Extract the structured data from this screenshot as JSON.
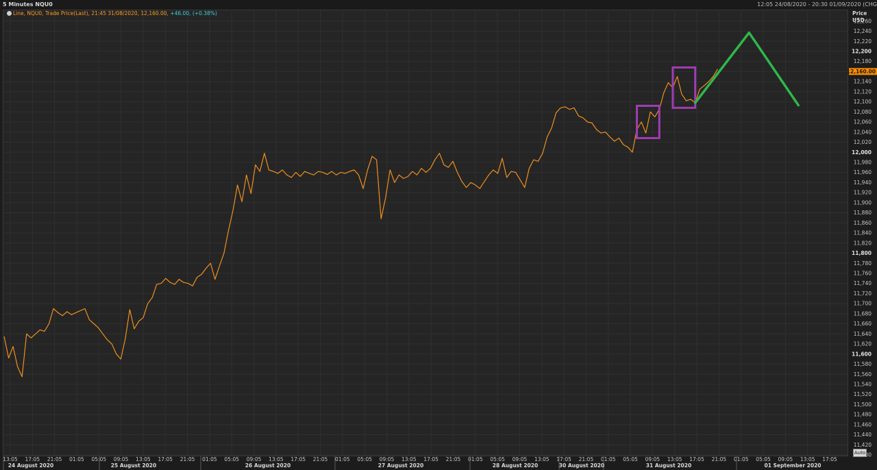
{
  "header": {
    "title": "5 Minutes NQU0",
    "range": "12:05 24/08/2020 - 20:30 01/09/2020 (CHG"
  },
  "legend": {
    "series_label": "Line, NQU0, Trade Price(Last), 21:45 31/08/2020, 12,160.00,",
    "change": "+46.00, (+0.38%)"
  },
  "price_axis": {
    "title_line1": "Price",
    "title_line2": "USD",
    "last_price_label": "12,160.00",
    "auto_button": "Auto"
  },
  "colors": {
    "price_line": "#f0901e",
    "last_price_tag": "#ff8c00",
    "highlight_box": "#a03cb4",
    "forecast_line": "#2fb84a",
    "grid": "#303030"
  },
  "chart_data": {
    "type": "line",
    "title": "5 Minutes NQU0",
    "ylabel": "Price USD",
    "ylim": [
      11400,
      12280
    ],
    "yticks": [
      11400,
      11420,
      11440,
      11460,
      11480,
      11500,
      11520,
      11540,
      11560,
      11580,
      11600,
      11620,
      11640,
      11660,
      11680,
      11700,
      11720,
      11740,
      11760,
      11780,
      11800,
      11820,
      11840,
      11860,
      11880,
      11900,
      11920,
      11940,
      11960,
      11980,
      12000,
      12020,
      12040,
      12060,
      12080,
      12100,
      12120,
      12140,
      12160,
      12180,
      12200,
      12220,
      12240,
      12260
    ],
    "ytick_labels": [
      "11,400",
      "11,420",
      "11,440",
      "11,460",
      "11,480",
      "11,500",
      "11,520",
      "11,540",
      "11,560",
      "11,580",
      "11,600",
      "11,620",
      "11,640",
      "11,660",
      "11,680",
      "11,700",
      "11,720",
      "11,740",
      "11,760",
      "11,780",
      "11,800",
      "11,820",
      "11,840",
      "11,860",
      "11,880",
      "11,900",
      "11,920",
      "11,940",
      "11,960",
      "11,980",
      "12,000",
      "12,020",
      "12,040",
      "12,060",
      "12,080",
      "12,100",
      "12,120",
      "12,140",
      "12,160",
      "12,180",
      "12,200",
      "12,220",
      "12,240",
      "12,260"
    ],
    "ytick_bold": [
      "11,600",
      "11,800",
      "12,000",
      "12,200"
    ],
    "x_time_ticks": [
      "13:05",
      "17:05",
      "21:05",
      "01:05",
      "05:05",
      "09:05",
      "13:05",
      "17:05",
      "21:05",
      "01:05",
      "05:05",
      "09:05",
      "13:05",
      "17:05",
      "21:05",
      "01:05",
      "05:05",
      "09:05",
      "13:05",
      "17:05",
      "21:05",
      "01:05",
      "05:05",
      "09:05",
      "13:05",
      "17:05",
      "21:05",
      "01:05",
      "05:05",
      "09:05",
      "13:05",
      "17:05",
      "21:05",
      "01:05",
      "05:05",
      "09:05",
      "13:05",
      "17:05"
    ],
    "x_date_labels": [
      "24 August 2020",
      "25 August 2020",
      "26 August 2020",
      "27 August 2020",
      "28 August 2020",
      "30 August 2020",
      "31 August 2020",
      "01 September 2020"
    ],
    "series": [
      {
        "name": "NQU0 Trade Price(Last)",
        "points": [
          [
            0,
            11635
          ],
          [
            1,
            11592
          ],
          [
            2,
            11615
          ],
          [
            3,
            11575
          ],
          [
            4,
            11555
          ],
          [
            5,
            11640
          ],
          [
            6,
            11632
          ],
          [
            7,
            11640
          ],
          [
            8,
            11648
          ],
          [
            9,
            11645
          ],
          [
            10,
            11660
          ],
          [
            11,
            11690
          ],
          [
            12,
            11682
          ],
          [
            13,
            11676
          ],
          [
            14,
            11684
          ],
          [
            15,
            11678
          ],
          [
            16,
            11682
          ],
          [
            17,
            11686
          ],
          [
            18,
            11690
          ],
          [
            19,
            11668
          ],
          [
            20,
            11660
          ],
          [
            21,
            11652
          ],
          [
            22,
            11640
          ],
          [
            23,
            11628
          ],
          [
            24,
            11620
          ],
          [
            25,
            11600
          ],
          [
            26,
            11590
          ],
          [
            27,
            11630
          ],
          [
            28,
            11688
          ],
          [
            29,
            11650
          ],
          [
            30,
            11665
          ],
          [
            31,
            11672
          ],
          [
            32,
            11700
          ],
          [
            33,
            11712
          ],
          [
            34,
            11738
          ],
          [
            35,
            11740
          ],
          [
            36,
            11750
          ],
          [
            37,
            11742
          ],
          [
            38,
            11738
          ],
          [
            39,
            11748
          ],
          [
            40,
            11742
          ],
          [
            41,
            11740
          ],
          [
            42,
            11735
          ],
          [
            43,
            11752
          ],
          [
            44,
            11758
          ],
          [
            45,
            11770
          ],
          [
            46,
            11780
          ],
          [
            47,
            11748
          ],
          [
            48,
            11775
          ],
          [
            49,
            11800
          ],
          [
            50,
            11845
          ],
          [
            51,
            11885
          ],
          [
            52,
            11935
          ],
          [
            53,
            11902
          ],
          [
            54,
            11955
          ],
          [
            55,
            11918
          ],
          [
            56,
            11975
          ],
          [
            57,
            11962
          ],
          [
            58,
            11998
          ],
          [
            59,
            11965
          ],
          [
            60,
            11962
          ],
          [
            61,
            11958
          ],
          [
            62,
            11965
          ],
          [
            63,
            11955
          ],
          [
            64,
            11950
          ],
          [
            65,
            11960
          ],
          [
            66,
            11952
          ],
          [
            67,
            11962
          ],
          [
            68,
            11958
          ],
          [
            69,
            11955
          ],
          [
            70,
            11962
          ],
          [
            71,
            11960
          ],
          [
            72,
            11956
          ],
          [
            73,
            11962
          ],
          [
            74,
            11955
          ],
          [
            75,
            11960
          ],
          [
            76,
            11958
          ],
          [
            77,
            11962
          ],
          [
            78,
            11965
          ],
          [
            79,
            11955
          ],
          [
            80,
            11928
          ],
          [
            81,
            11965
          ],
          [
            82,
            11992
          ],
          [
            83,
            11985
          ],
          [
            84,
            11868
          ],
          [
            85,
            11910
          ],
          [
            86,
            11965
          ],
          [
            87,
            11940
          ],
          [
            88,
            11955
          ],
          [
            89,
            11948
          ],
          [
            90,
            11952
          ],
          [
            91,
            11962
          ],
          [
            92,
            11955
          ],
          [
            93,
            11968
          ],
          [
            94,
            11960
          ],
          [
            95,
            11968
          ],
          [
            96,
            11985
          ],
          [
            97,
            11998
          ],
          [
            98,
            11975
          ],
          [
            99,
            11970
          ],
          [
            100,
            11982
          ],
          [
            101,
            11960
          ],
          [
            102,
            11942
          ],
          [
            103,
            11930
          ],
          [
            104,
            11940
          ],
          [
            105,
            11935
          ],
          [
            106,
            11928
          ],
          [
            107,
            11942
          ],
          [
            108,
            11955
          ],
          [
            109,
            11965
          ],
          [
            110,
            11958
          ],
          [
            111,
            11988
          ],
          [
            112,
            11950
          ],
          [
            113,
            11962
          ],
          [
            114,
            11960
          ],
          [
            115,
            11945
          ],
          [
            116,
            11930
          ],
          [
            117,
            11968
          ],
          [
            118,
            11985
          ],
          [
            119,
            11982
          ],
          [
            120,
            11998
          ],
          [
            121,
            12030
          ],
          [
            122,
            12048
          ],
          [
            123,
            12078
          ],
          [
            124,
            12088
          ],
          [
            125,
            12090
          ],
          [
            126,
            12085
          ],
          [
            127,
            12088
          ],
          [
            128,
            12072
          ],
          [
            129,
            12068
          ],
          [
            130,
            12060
          ],
          [
            131,
            12058
          ],
          [
            132,
            12045
          ],
          [
            133,
            12038
          ],
          [
            134,
            12040
          ],
          [
            135,
            12030
          ],
          [
            136,
            12022
          ],
          [
            137,
            12028
          ],
          [
            138,
            12015
          ],
          [
            139,
            12010
          ],
          [
            140,
            12000
          ],
          [
            141,
            12045
          ],
          [
            142,
            12060
          ],
          [
            143,
            12038
          ],
          [
            144,
            12080
          ],
          [
            145,
            12070
          ],
          [
            146,
            12085
          ],
          [
            147,
            12118
          ],
          [
            148,
            12138
          ],
          [
            149,
            12128
          ],
          [
            150,
            12150
          ],
          [
            151,
            12115
          ],
          [
            152,
            12102
          ],
          [
            153,
            12105
          ],
          [
            154,
            12098
          ],
          [
            155,
            12125
          ],
          [
            156,
            12132
          ],
          [
            157,
            12140
          ],
          [
            158,
            12150
          ],
          [
            159,
            12165
          ]
        ]
      }
    ],
    "annotations": [
      {
        "type": "box",
        "x_from": 141,
        "x_to": 146,
        "y_from": 12028,
        "y_to": 12092
      },
      {
        "type": "box",
        "x_from": 149,
        "x_to": 154,
        "y_from": 12088,
        "y_to": 12168
      },
      {
        "type": "forecast-line",
        "points": [
          [
            154,
            12098
          ],
          [
            166,
            12237
          ],
          [
            177,
            12093
          ]
        ]
      }
    ]
  }
}
